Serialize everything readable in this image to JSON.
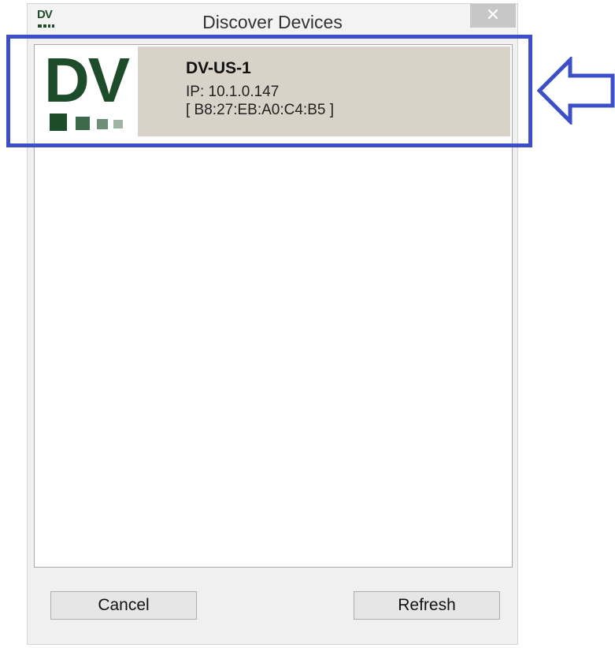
{
  "window": {
    "title": "Discover Devices",
    "icon_text": "DV",
    "close_glyph": "✕"
  },
  "device_list": {
    "items": [
      {
        "logo_text": "DV",
        "name": "DV-US-1",
        "ip": "IP: 10.1.0.147",
        "mac": "[ B8:27:EB:A0:C4:B5 ]",
        "selected": true
      }
    ]
  },
  "buttons": {
    "cancel_label": "Cancel",
    "refresh_label": "Refresh"
  },
  "colors": {
    "selection_bg": "#d8d2c9",
    "brand_green": "#1c4c2a",
    "annotation_blue": "#3c4fc8"
  },
  "icons": {
    "app": "dv-logo-icon",
    "close": "close-icon",
    "annotation": "arrow-left-icon"
  }
}
